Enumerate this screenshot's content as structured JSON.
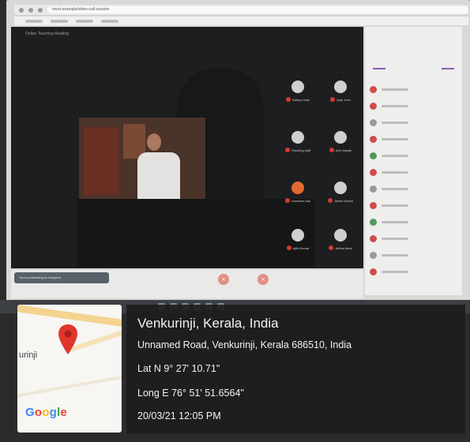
{
  "browser": {
    "url": "meet.example/video-call-session"
  },
  "meeting": {
    "title": "Online Teaching Meeting",
    "message_pill": "You're presenting to everyone",
    "participants": [
      {
        "name": "Sathya Jose"
      },
      {
        "name": "Anju John"
      },
      {
        "name": "Teaching staff"
      },
      {
        "name": "Anil Joseph"
      },
      {
        "name": "Aneesha Das"
      },
      {
        "name": "Jismin Kurian"
      },
      {
        "name": "Ajith Kumar"
      },
      {
        "name": "Anitha Mani"
      }
    ]
  },
  "location": {
    "place": "Venkurinji, Kerala, India",
    "address": "Unnamed Road, Venkurinji, Kerala 686510, India",
    "latitude": "Lat N 9° 27' 10.71\"",
    "longitude": "Long E 76° 51' 51.6564\"",
    "timestamp": "20/03/21 12:05 PM"
  },
  "map": {
    "place_label": "urinji",
    "logo": "Google"
  },
  "colors": {
    "pin": "#e0352b",
    "google_blue": "#4285f4",
    "google_red": "#ea4335",
    "google_yellow": "#fbbc05",
    "google_green": "#34a853"
  }
}
